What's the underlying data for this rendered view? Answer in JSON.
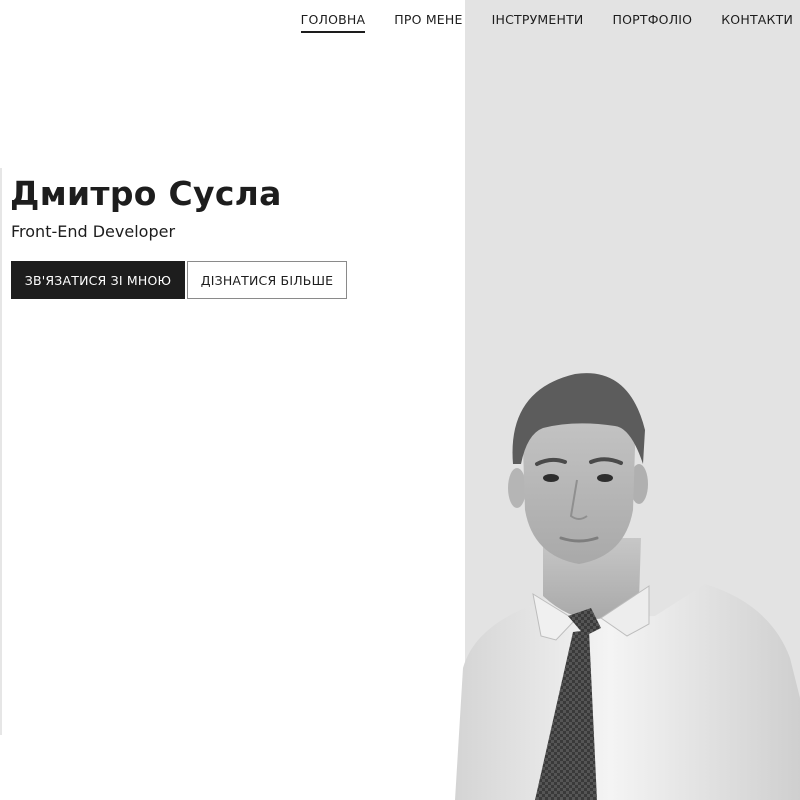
{
  "nav": {
    "items": [
      {
        "label": "ГОЛОВНА",
        "active": true
      },
      {
        "label": "ПРО МЕНЕ",
        "active": false
      },
      {
        "label": "ІНСТРУМЕНТИ",
        "active": false
      },
      {
        "label": "ПОРТФОЛІО",
        "active": false
      },
      {
        "label": "КОНТАКТИ",
        "active": false
      }
    ]
  },
  "hero": {
    "name": "Дмитро Сусла",
    "role": "Front-End Developer",
    "primary_button": "ЗВ'ЯЗАТИСЯ ЗІ МНОЮ",
    "secondary_button": "ДІЗНАТИСЯ БІЛЬШЕ"
  },
  "colors": {
    "text": "#1d1d1d",
    "panel": "#e3e3e3",
    "primary_button_bg": "#1d1d1d",
    "primary_button_text": "#ffffff"
  }
}
